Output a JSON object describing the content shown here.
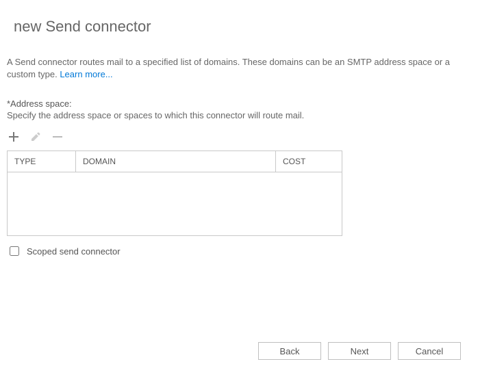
{
  "title": "new Send connector",
  "description": "A Send connector routes mail to a specified list of domains. These domains can be an SMTP address space or a custom type.",
  "learn_more": "Learn more...",
  "address_space": {
    "label": "*Address space:",
    "sub": "Specify the address space or spaces to which this connector will route mail."
  },
  "columns": {
    "type": "TYPE",
    "domain": "DOMAIN",
    "cost": "COST"
  },
  "rows": [],
  "scoped_label": "Scoped send connector",
  "scoped_checked": false,
  "buttons": {
    "back": "Back",
    "next": "Next",
    "cancel": "Cancel"
  },
  "icons": {
    "add": "add-icon",
    "edit": "edit-icon",
    "remove": "remove-icon"
  }
}
